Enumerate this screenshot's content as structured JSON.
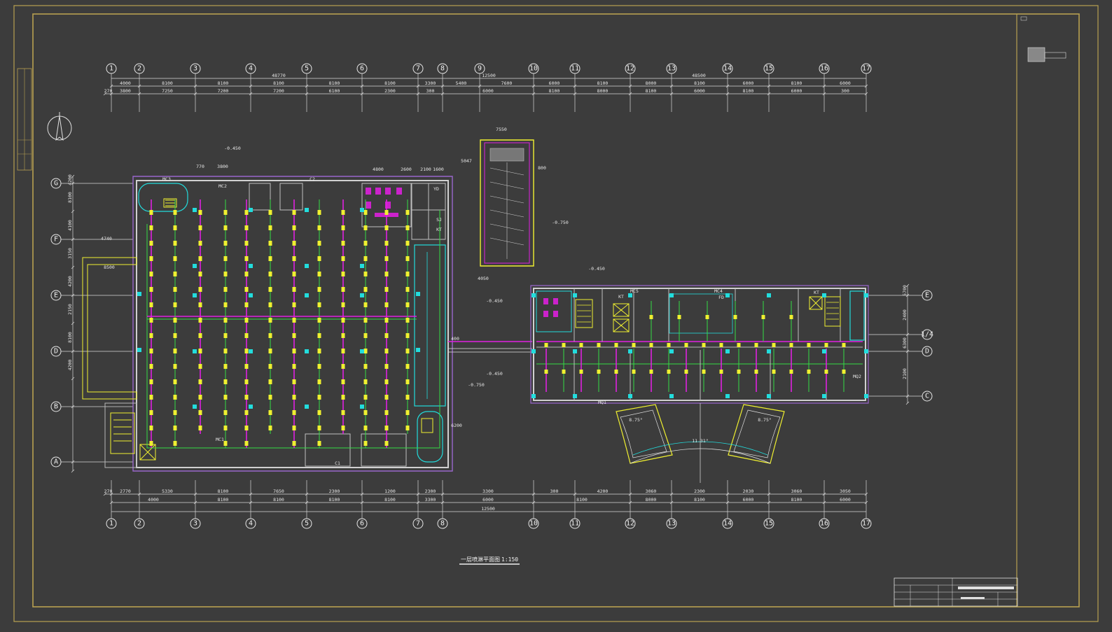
{
  "drawing": {
    "title": "一层喷淋平面图",
    "scale": "1:150",
    "colors": {
      "background": "#3c3c3c",
      "frame": "#b8a050",
      "wall": "#d0d0d0",
      "sprinkler_pipe": "#e020e0",
      "branch_pipe": "#33dd44",
      "fire_pipe": "#22dddd",
      "annotation": "#f0f030"
    }
  },
  "axes": {
    "top_labels": [
      "1",
      "2",
      "3",
      "4",
      "5",
      "6",
      "7",
      "8",
      "9",
      "10",
      "11",
      "12",
      "13",
      "14",
      "15",
      "16",
      "17"
    ],
    "bottom_labels": [
      "1",
      "2",
      "3",
      "4",
      "5",
      "6",
      "7",
      "8",
      "10",
      "11",
      "12",
      "13",
      "14",
      "15",
      "16",
      "17"
    ],
    "left_labels": [
      "G",
      "F",
      "E",
      "D",
      "B",
      "A"
    ],
    "right_labels": [
      "E",
      "1/4",
      "D",
      "C"
    ]
  },
  "dimensions": {
    "top_totals": [
      "48770",
      "12500",
      "48500"
    ],
    "top_row1": [
      "4000",
      "8100",
      "8100",
      "8100",
      "8100",
      "8100",
      "3300",
      "5400",
      "7600",
      "6000",
      "8100",
      "8000",
      "8100",
      "6000",
      "8100",
      "6000"
    ],
    "top_row2": [
      "270",
      "3800",
      "7250",
      "7200",
      "7200",
      "6100",
      "2300",
      "300",
      "6000",
      "8100",
      "8000",
      "8100",
      "6000",
      "8100",
      "6000",
      "300"
    ],
    "bottom_row1": [
      "270",
      "2770",
      "5330",
      "8100",
      "7650",
      "2300",
      "1200",
      "2300",
      "3300",
      "300",
      "4200",
      "3060",
      "2300",
      "2030",
      "3060",
      "3050",
      "300"
    ],
    "bottom_row2": [
      "4000",
      "8100",
      "8100",
      "8100",
      "8100",
      "3300",
      "6000",
      "8100",
      "8000",
      "8100",
      "6000",
      "8100",
      "6000"
    ],
    "bottom_total": "12500",
    "left": [
      "4200",
      "8100",
      "4100",
      "3150",
      "4200",
      "2150",
      "8100",
      "4200"
    ],
    "right": [
      "5700",
      "2400",
      "6300",
      "2100"
    ]
  },
  "labels": {
    "elev_a": "-0.450",
    "elev_b": "-0.750",
    "elev_c": "-0.450",
    "elev_d": "-0.450",
    "elev_e": "-0.450",
    "elev_f": "-0.750",
    "angle_a": "8.75°",
    "angle_b": "8.75°",
    "angle_c": "11.31°",
    "dim_7550": "7550",
    "dim_4740": "4740",
    "dim_8500": "8500",
    "dim_2600": "2600",
    "dim_4800": "4800",
    "dim_2100": "2100",
    "dim_1600": "1600",
    "dim_3800": "3800",
    "dim_5047": "5047",
    "dim_400": "400",
    "dim_800": "800",
    "dim_4050": "4050",
    "dim_770": "770",
    "dim_6200": "6200"
  },
  "rooms": {
    "kt1": "KT",
    "kt2": "KT",
    "kt3": "KT",
    "sj": "SJ",
    "yd": "YD",
    "fd": "FD",
    "mc1": "MC1",
    "mc2": "MC2",
    "mc3": "MC3",
    "mc4": "MC4",
    "mc5": "MC5",
    "mq1": "MQ1",
    "mq2": "MQ2",
    "c1": "C1",
    "c2": "C2"
  }
}
